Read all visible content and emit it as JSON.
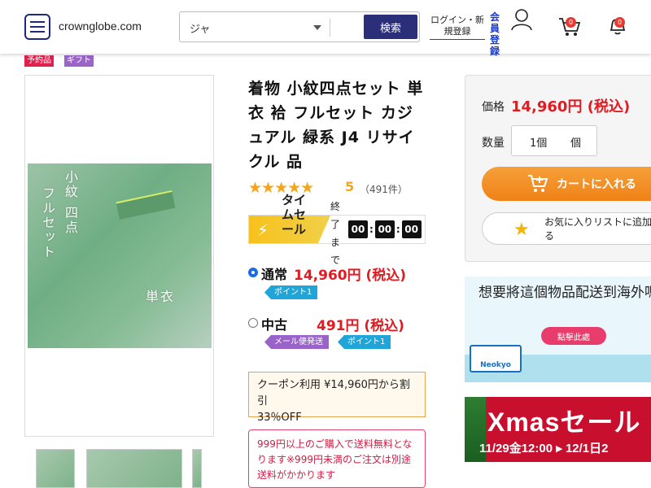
{
  "header": {
    "site": "crownglobe.com",
    "search_category": "ジャ",
    "search_button": "検索",
    "login_label": "ログイン・新規登録",
    "register_label": "会員登録",
    "cart_count": "0",
    "notify_count": "0"
  },
  "tags": [
    "予約品",
    "ギフト"
  ],
  "product": {
    "title": "着物 小紋四点セット 単衣 袷 フルセット カジュアル 緑系 J4 リサイクル 品",
    "stars": "★★★★★",
    "rating": "5",
    "reviews": "（491件）",
    "flash_label": "タイムセール",
    "flash_sub": "終了まで",
    "timer": [
      "00",
      "00",
      "00"
    ],
    "option1_name": "通常",
    "option1_price": "14,960円 (税込)",
    "option1_pill": "ポイント1",
    "option2_name": "中古",
    "option2_price": "491円 (税込)",
    "option2_pill_a": "メール便発送",
    "option2_pill_b": "ポイント1",
    "coupon_line1": "クーポン利用 ¥14,960円から割引",
    "coupon_line2": "33％OFF",
    "notice": "999円以上のご購入で送料無料となります※999円未満のご注文は別途送料がかかります",
    "photo_text1": "小紋",
    "photo_text2": "四点",
    "photo_text3": "フルセット",
    "photo_text4": "単衣"
  },
  "buybox": {
    "price_label": "価格",
    "price": "14,960円 (税込)",
    "qty_label": "数量",
    "qty_value": "1個",
    "qty_unit": "個",
    "cart_button": "カートに入れる",
    "fav_button": "お気に入りリストに追加する"
  },
  "banners": {
    "shipping_title": "想要將這個物品配送到海外嗎?",
    "shipping_button": "點擊此處",
    "truck_brand": "Neokyo",
    "xmas_title": "Xmasセール",
    "xmas_dates": "11/29金12:00 ▸ 12/1日2"
  },
  "colors": {
    "brand_navy": "#1e2a78",
    "price_red": "#e01b22",
    "cart_orange": "#ef8216",
    "star_gold": "#f4a51c"
  }
}
